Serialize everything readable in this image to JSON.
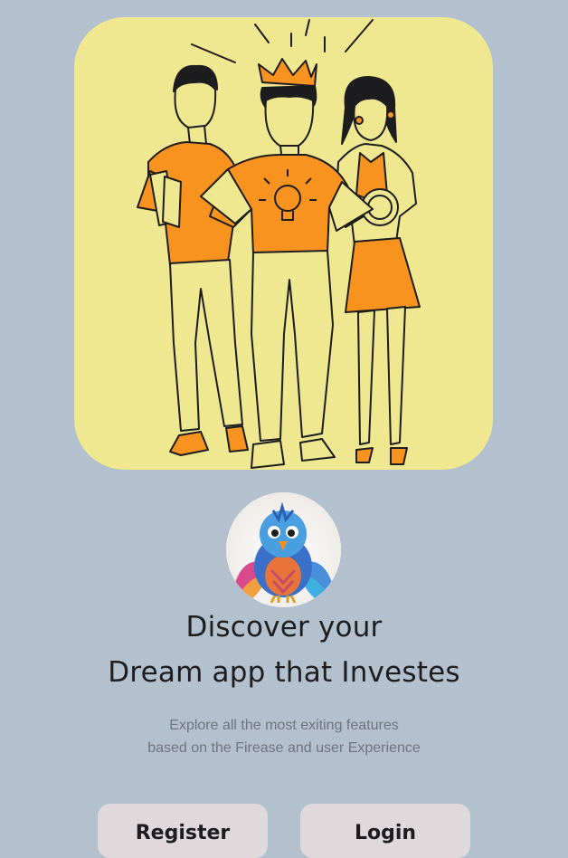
{
  "hero": {
    "illustration": "three-people-illustration",
    "background_color": "#f0e890",
    "accent_color": "#f7931e"
  },
  "avatar": {
    "icon": "bird-logo"
  },
  "headline": {
    "line1": "Discover your",
    "line2": "Dream app that Investes"
  },
  "subtitle": {
    "line1": "Explore all the most exiting features",
    "line2": "based on the Firease and user Experience"
  },
  "buttons": {
    "register_label": "Register",
    "login_label": "Login"
  },
  "colors": {
    "page_background": "#b3c1cf",
    "button_background": "#dfd9dc",
    "headline_text": "#1d1d1f",
    "subtitle_text": "#6f737a"
  }
}
